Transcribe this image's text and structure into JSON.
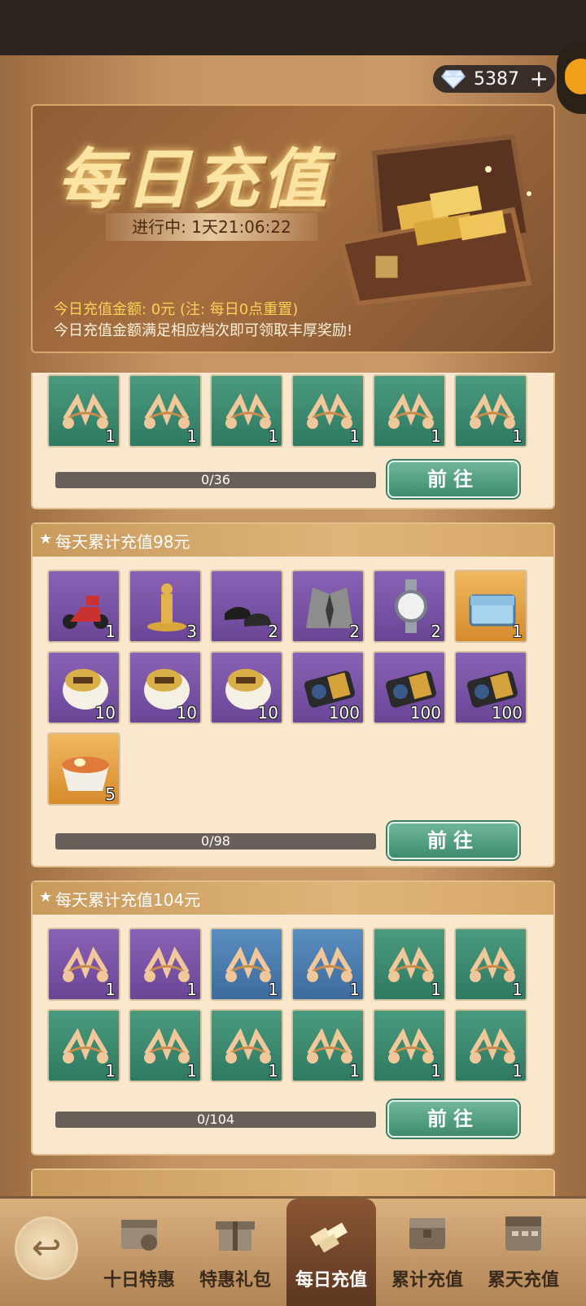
{
  "currency": {
    "diamonds": "5387",
    "plus": "+"
  },
  "banner": {
    "title": "每日充值",
    "timer": "进行中: 1天21:06:22",
    "amount": "今日充值金额: 0元 (注: 每日0点重置)",
    "hint": "今日充值金额满足相应档次即可领取丰厚奖励!"
  },
  "cards": [
    {
      "title": "",
      "items": [
        {
          "icon": "string-figure-icon",
          "color": "green",
          "count": "1"
        },
        {
          "icon": "string-figure-icon",
          "color": "green",
          "count": "1"
        },
        {
          "icon": "string-figure-icon",
          "color": "green",
          "count": "1"
        },
        {
          "icon": "string-figure-icon",
          "color": "green",
          "count": "1"
        },
        {
          "icon": "string-figure-icon",
          "color": "green",
          "count": "1"
        },
        {
          "icon": "string-figure-icon",
          "color": "green",
          "count": "1"
        }
      ],
      "progress": "0/36",
      "button": "前往"
    },
    {
      "title": "每天累计充值98元",
      "items": [
        {
          "icon": "scooter-icon",
          "color": "purple",
          "count": "1"
        },
        {
          "icon": "trophy-statue-icon",
          "color": "purple",
          "count": "3"
        },
        {
          "icon": "leather-shoes-icon",
          "color": "purple",
          "count": "2"
        },
        {
          "icon": "suit-jacket-icon",
          "color": "purple",
          "count": "2"
        },
        {
          "icon": "wristwatch-icon",
          "color": "purple",
          "count": "2"
        },
        {
          "icon": "supply-chest-icon",
          "color": "orange",
          "count": "1"
        },
        {
          "icon": "cosmetic-jar-icon",
          "color": "purple",
          "count": "10"
        },
        {
          "icon": "cosmetic-jar-icon",
          "color": "purple",
          "count": "10"
        },
        {
          "icon": "cosmetic-jar-icon",
          "color": "purple",
          "count": "10"
        },
        {
          "icon": "film-roll-icon",
          "color": "purple",
          "count": "100"
        },
        {
          "icon": "film-roll-icon",
          "color": "purple",
          "count": "100"
        },
        {
          "icon": "film-roll-icon",
          "color": "purple",
          "count": "100"
        },
        {
          "icon": "noodle-bowl-icon",
          "color": "orange",
          "count": "5"
        }
      ],
      "progress": "0/98",
      "button": "前往"
    },
    {
      "title": "每天累计充值104元",
      "items": [
        {
          "icon": "string-figure-icon",
          "color": "purple",
          "count": "1"
        },
        {
          "icon": "string-figure-icon",
          "color": "purple",
          "count": "1"
        },
        {
          "icon": "string-figure-icon",
          "color": "blue",
          "count": "1"
        },
        {
          "icon": "string-figure-icon",
          "color": "blue",
          "count": "1"
        },
        {
          "icon": "string-figure-icon",
          "color": "green",
          "count": "1"
        },
        {
          "icon": "string-figure-icon",
          "color": "green",
          "count": "1"
        },
        {
          "icon": "string-figure-icon",
          "color": "green",
          "count": "1"
        },
        {
          "icon": "string-figure-icon",
          "color": "green",
          "count": "1"
        },
        {
          "icon": "string-figure-icon",
          "color": "green",
          "count": "1"
        },
        {
          "icon": "string-figure-icon",
          "color": "green",
          "count": "1"
        },
        {
          "icon": "string-figure-icon",
          "color": "green",
          "count": "1"
        },
        {
          "icon": "string-figure-icon",
          "color": "green",
          "count": "1"
        }
      ],
      "progress": "0/104",
      "button": "前往"
    }
  ],
  "tabs": [
    {
      "label": "十日特惠",
      "icon": "calendar-gift-icon",
      "active": false
    },
    {
      "label": "特惠礼包",
      "icon": "gift-box-icon",
      "active": false
    },
    {
      "label": "每日充值",
      "icon": "gold-bars-icon",
      "active": true
    },
    {
      "label": "累计充值",
      "icon": "treasure-chest-icon",
      "active": false
    },
    {
      "label": "累天充值",
      "icon": "calendar-icon",
      "active": false
    }
  ],
  "colors": {
    "accent_green": "#4a9a7e",
    "card_bg": "#fbe7cd",
    "title_gold": "#fbe3a4"
  }
}
